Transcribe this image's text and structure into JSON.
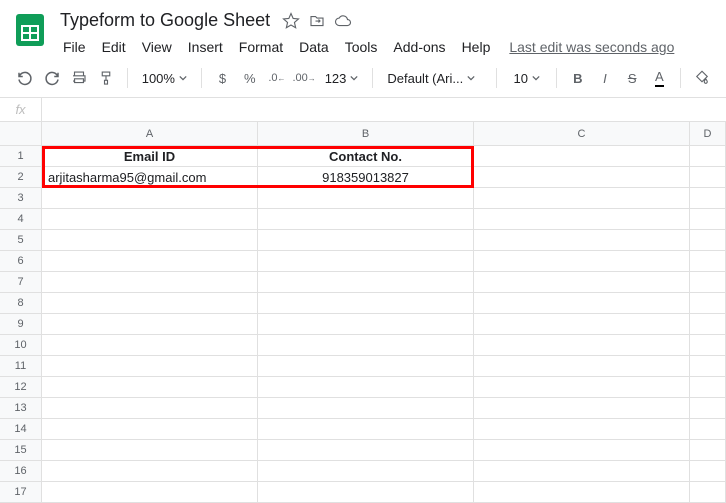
{
  "doc": {
    "title": "Typeform to Google Sheet"
  },
  "menu": {
    "file": "File",
    "edit": "Edit",
    "view": "View",
    "insert": "Insert",
    "format": "Format",
    "data": "Data",
    "tools": "Tools",
    "addons": "Add-ons",
    "help": "Help",
    "last_edit": "Last edit was seconds ago"
  },
  "toolbar": {
    "zoom": "100%",
    "dollar": "$",
    "percent": "%",
    "dec_dec": ".0",
    "dec_inc": ".00",
    "num_fmt": "123",
    "font": "Default (Ari...",
    "size": "10",
    "bold": "B",
    "italic": "I",
    "strike": "S",
    "text_color": "A"
  },
  "fx": {
    "label": "fx",
    "value": ""
  },
  "columns": {
    "a": "A",
    "b": "B",
    "c": "C",
    "d": "D"
  },
  "rows": [
    "1",
    "2",
    "3",
    "4",
    "5",
    "6",
    "7",
    "8",
    "9",
    "10",
    "11",
    "12",
    "13",
    "14",
    "15",
    "16",
    "17"
  ],
  "sheet": {
    "headers": {
      "a": "Email ID",
      "b": "Contact No."
    },
    "row2": {
      "a": "arjitasharma95@gmail.com",
      "b": "918359013827"
    }
  }
}
